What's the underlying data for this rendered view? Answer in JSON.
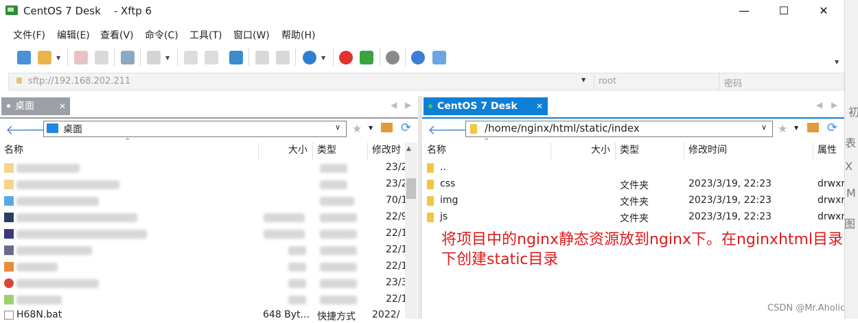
{
  "window": {
    "title": "CentOS 7 Desk    - Xftp 6",
    "minimize": "—",
    "maximize": "☐",
    "close": "✕"
  },
  "menu": [
    "文件(F)",
    "编辑(E)",
    "查看(V)",
    "命令(C)",
    "工具(T)",
    "窗口(W)",
    "帮助(H)"
  ],
  "address": {
    "url": "sftp://192.168.202.211",
    "user_placeholder": "root",
    "password_placeholder": "密码"
  },
  "left_pane": {
    "tab": "桌面",
    "path": "桌面",
    "columns": [
      "名称",
      "大小",
      "类型",
      "修改时"
    ],
    "rows": [
      {
        "date": "23/2"
      },
      {
        "date": "23/2"
      },
      {
        "date": "70/1"
      },
      {
        "date": "22/9"
      },
      {
        "date": "22/1"
      },
      {
        "date": "22/1"
      },
      {
        "date": "22/1"
      },
      {
        "date": "23/3"
      },
      {
        "date": "22/1"
      },
      {
        "name": "H68N.bat",
        "size": "648 Byt...",
        "type": "快捷方式",
        "date": "2022/"
      }
    ]
  },
  "right_pane": {
    "tab": "CentOS 7 Desk",
    "path": "/home/nginx/html/static/index",
    "columns": [
      "名称",
      "大小",
      "类型",
      "修改时间",
      "属性"
    ],
    "rows": [
      {
        "name": "..",
        "type": "",
        "date": "",
        "attr": ""
      },
      {
        "name": "css",
        "type": "文件夹",
        "date": "2023/3/19, 22:23",
        "attr": "drwxr"
      },
      {
        "name": "img",
        "type": "文件夹",
        "date": "2023/3/19, 22:23",
        "attr": "drwxr"
      },
      {
        "name": "js",
        "type": "文件夹",
        "date": "2023/3/19, 22:23",
        "attr": "drwxr"
      }
    ]
  },
  "annotation": "将项目中的nginx静态资源放到nginx下。在nginxhtml目录下创建static目录",
  "watermark": "CSDN @Mr.Aholic",
  "side_strip": [
    "初",
    "表",
    "X",
    "M",
    "图"
  ]
}
